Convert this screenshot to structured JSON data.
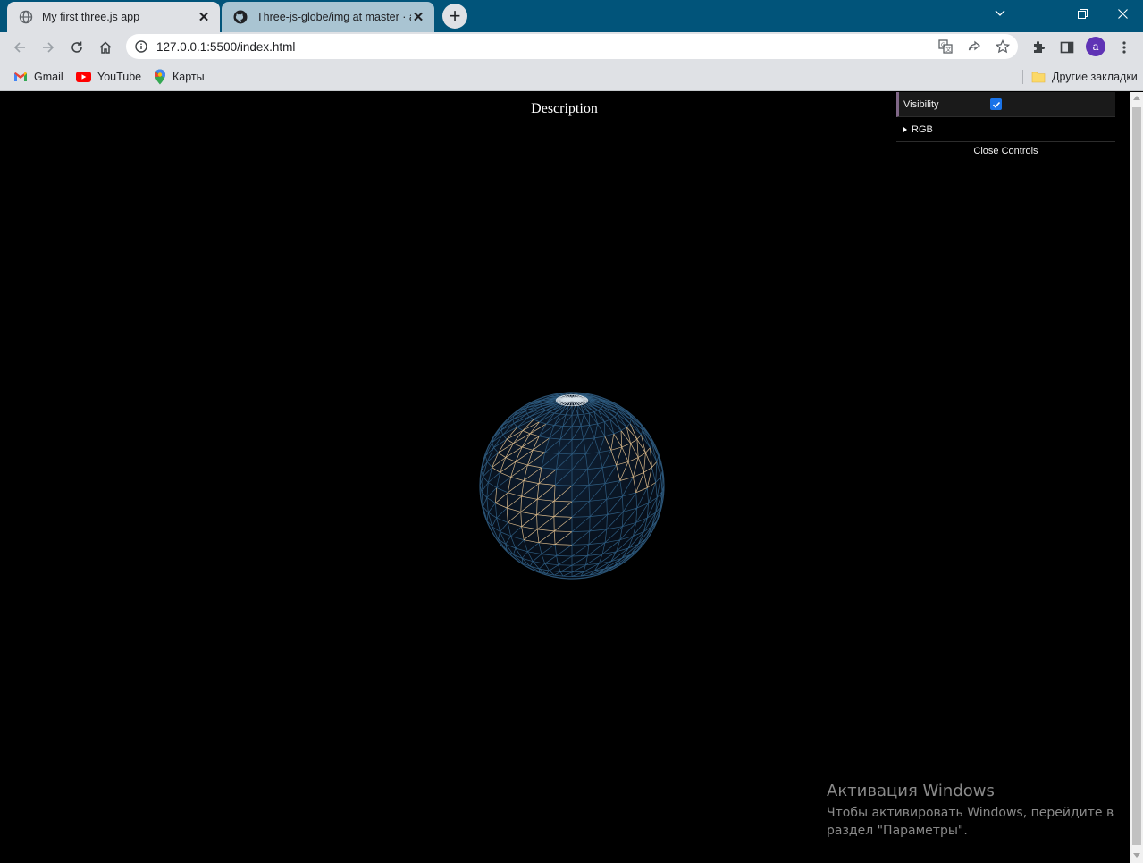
{
  "tabs": [
    {
      "title": "My first three.js app",
      "icon": "globe-icon",
      "active": true
    },
    {
      "title": "Three-js-globe/img at master · a",
      "icon": "github-icon",
      "active": false
    }
  ],
  "toolbar": {
    "url": "127.0.0.1:5500/index.html",
    "avatar_letter": "a"
  },
  "bookmarks": [
    {
      "label": "Gmail",
      "icon": "gmail-icon"
    },
    {
      "label": "YouTube",
      "icon": "youtube-icon"
    },
    {
      "label": "Карты",
      "icon": "maps-icon"
    }
  ],
  "other_bookmarks": "Другие закладки",
  "page": {
    "description": "Description"
  },
  "gui": {
    "visibility_label": "Visibility",
    "visibility_checked": true,
    "folder_label": "RGB",
    "close_label": "Close Controls"
  },
  "watermark": {
    "title": "Активация Windows",
    "subtitle": "Чтобы активировать Windows, перейдите в раздел \"Параметры\"."
  },
  "colors": {
    "titlebar": "#01547a",
    "toolbar": "#dfe1e5",
    "page_bg": "#000000",
    "gui_accent": "#806787",
    "avatar": "#5f33b5"
  }
}
